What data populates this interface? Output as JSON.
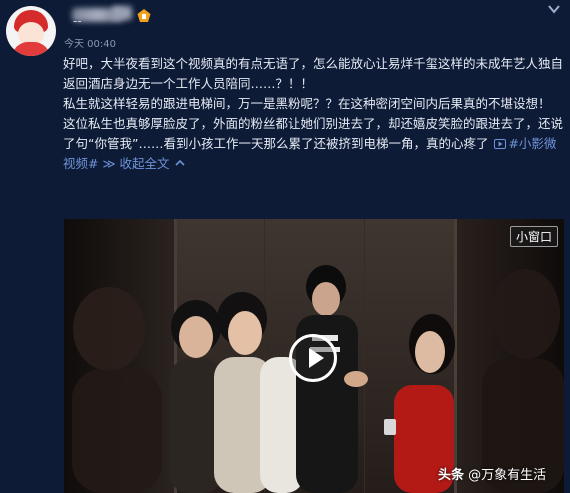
{
  "post": {
    "author_name": "--",
    "timestamp": "今天 00:40",
    "paragraphs": [
      "好吧，大半夜看到这个视频真的有点无语了，怎么能放心让易烊千玺这样的未成年艺人独自返回酒店身边无一个工作人员陪同……？！！",
      "私生就这样轻易的跟进电梯间，万一是黑粉呢？？在这种密闭空间内后果真的不堪设想！",
      "这位私生也真够厚脸皮了，外面的粉丝都让她们别进去了，却还嬉皮笑脸的跟进去了，还说了句“你管我”……看到小孩工作一天那么累了还被挤到电梯一角，真的心疼了"
    ],
    "video_link": "#小影微视频#",
    "collapse_label": "收起全文"
  },
  "video": {
    "mini_window_label": "小窗口",
    "watermark_brand": "头条",
    "watermark_author": "@万象有生活"
  },
  "colors": {
    "background": "#0d1b36",
    "text": "#e6ebf5",
    "link": "#6f93d8",
    "timestamp": "#8d97ad"
  },
  "icons": {
    "vip": "vip-badge-icon",
    "collapse": "chevron-down-icon",
    "video_link": "video-link-icon",
    "play": "play-icon"
  }
}
